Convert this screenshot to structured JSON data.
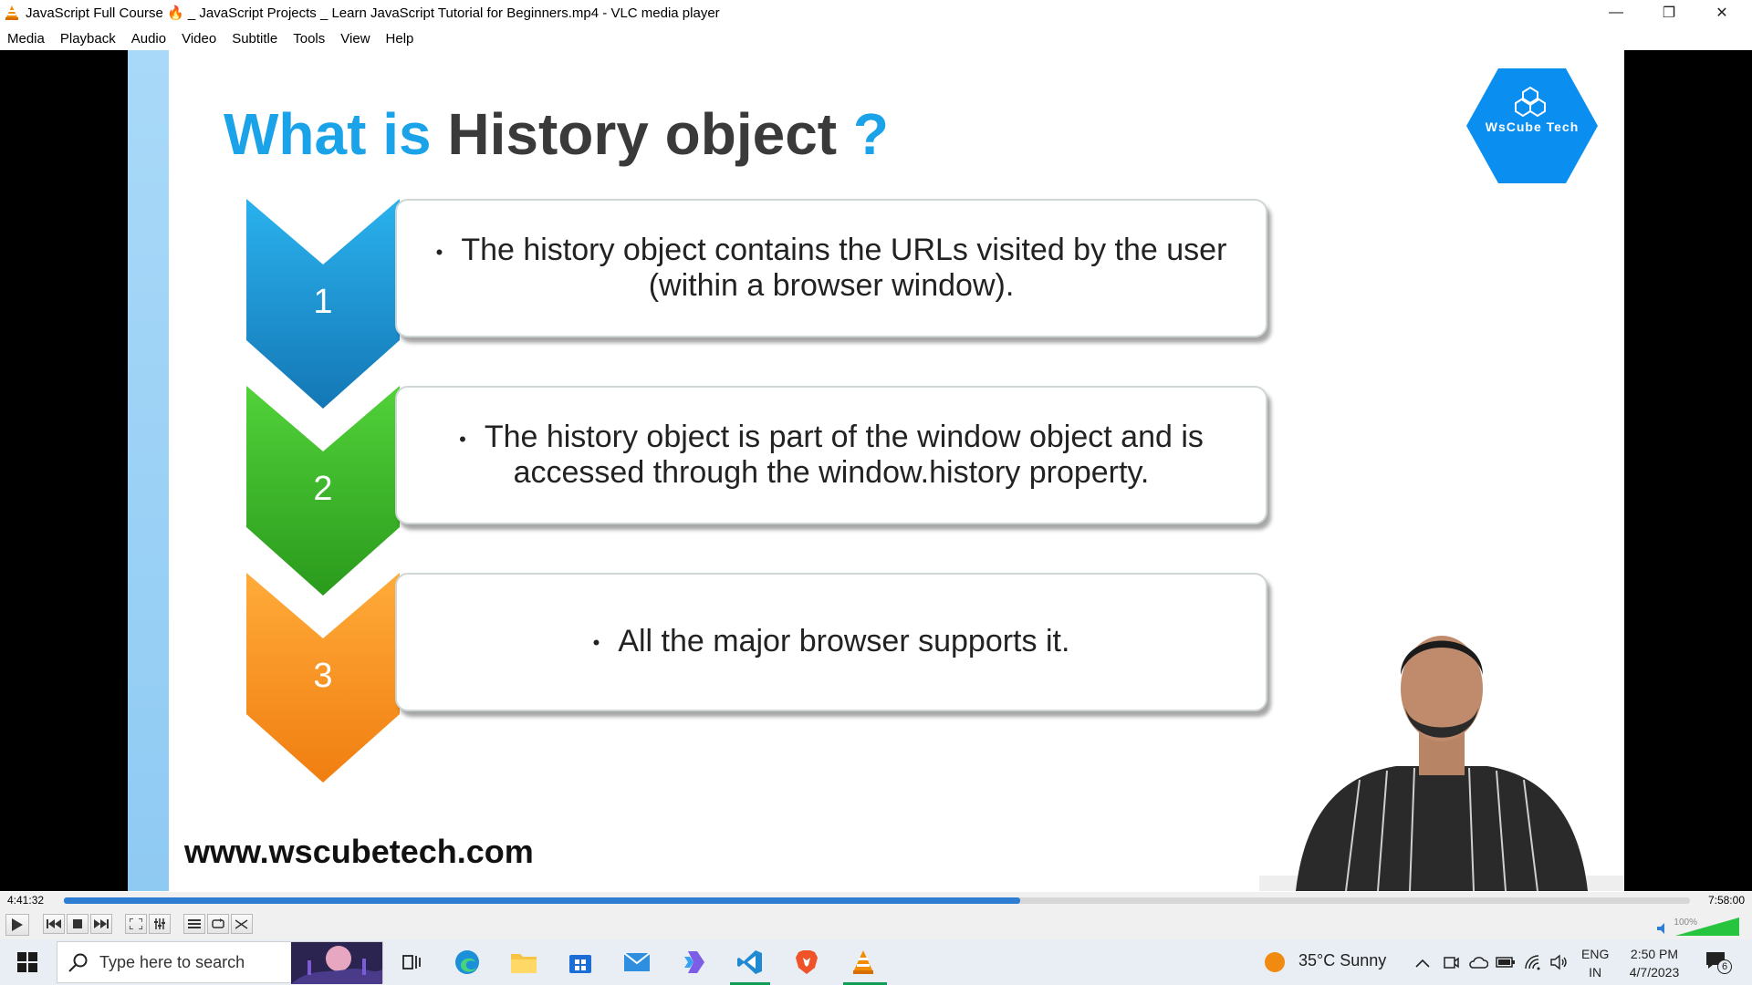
{
  "window": {
    "title": "JavaScript Full Course 🔥 _ JavaScript Projects _ Learn JavaScript Tutorial for Beginners.mp4 - VLC media player",
    "minimize": "—",
    "restore": "❐",
    "close": "✕"
  },
  "menu": [
    "Media",
    "Playback",
    "Audio",
    "Video",
    "Subtitle",
    "Tools",
    "View",
    "Help"
  ],
  "slide": {
    "title_hl": "What is",
    "title_rest": " History object",
    "title_q": " ?",
    "logo_text": "WsCube Tech",
    "items": [
      {
        "num": "1",
        "line1": "The history object contains the URLs visited by the user",
        "line2": "(within a browser window).",
        "color": "#1f9bd8"
      },
      {
        "num": "2",
        "line1": "The history object is part of the window object and is",
        "line2": "accessed through the window.history property.",
        "color": "#3dbb29"
      },
      {
        "num": "3",
        "line1": "All the major browser supports it.",
        "line2": "",
        "color": "#f7951d"
      }
    ],
    "url": "www.wscubetech.com"
  },
  "player": {
    "time_elapsed": "4:41:32",
    "time_total": "7:58:00",
    "progress": 0.588,
    "volume": "100%"
  },
  "taskbar": {
    "search_placeholder": "Type here to search",
    "weather": "35°C  Sunny",
    "lang_line1": "ENG",
    "lang_line2": "IN",
    "time": "2:50 PM",
    "date": "4/7/2023",
    "notifications": "6"
  }
}
